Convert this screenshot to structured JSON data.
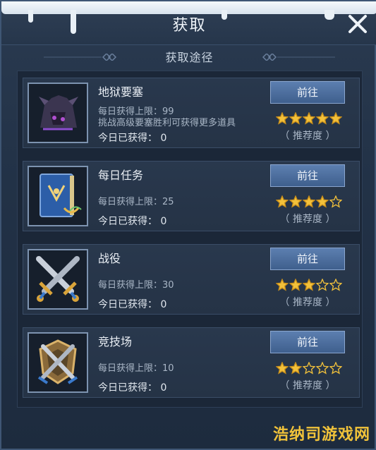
{
  "header": {
    "title": "获取"
  },
  "section": {
    "title": "获取途径"
  },
  "colors": {
    "accent": "#4f73a6",
    "star_gold": "#f2c13b",
    "panel": "#233247"
  },
  "rows": [
    {
      "name": "地狱要塞",
      "limit": "每日获得上限：99",
      "hint": "挑战高级要塞胜利可获得更多道具",
      "today": "今日已获得： 0",
      "button": "前往",
      "rating": 5,
      "rating_label": "（ 推荐度 ）",
      "icon": "fortress-icon"
    },
    {
      "name": "每日任务",
      "limit": "每日获得上限：25",
      "hint": "",
      "today": "今日已获得： 0",
      "button": "前往",
      "rating": 4,
      "rating_label": "（ 推荐度 ）",
      "icon": "book-icon"
    },
    {
      "name": "战役",
      "limit": "每日获得上限：30",
      "hint": "",
      "today": "今日已获得： 0",
      "button": "前往",
      "rating": 3,
      "rating_label": "（ 推荐度 ）",
      "icon": "crossed-swords-icon"
    },
    {
      "name": "竞技场",
      "limit": "每日获得上限：10",
      "hint": "",
      "today": "今日已获得： 0",
      "button": "前往",
      "rating": 2,
      "rating_label": "（ 推荐度 ）",
      "icon": "arena-emblem-icon"
    }
  ],
  "max_rating": 5,
  "watermark": "浩纳司游戏网"
}
